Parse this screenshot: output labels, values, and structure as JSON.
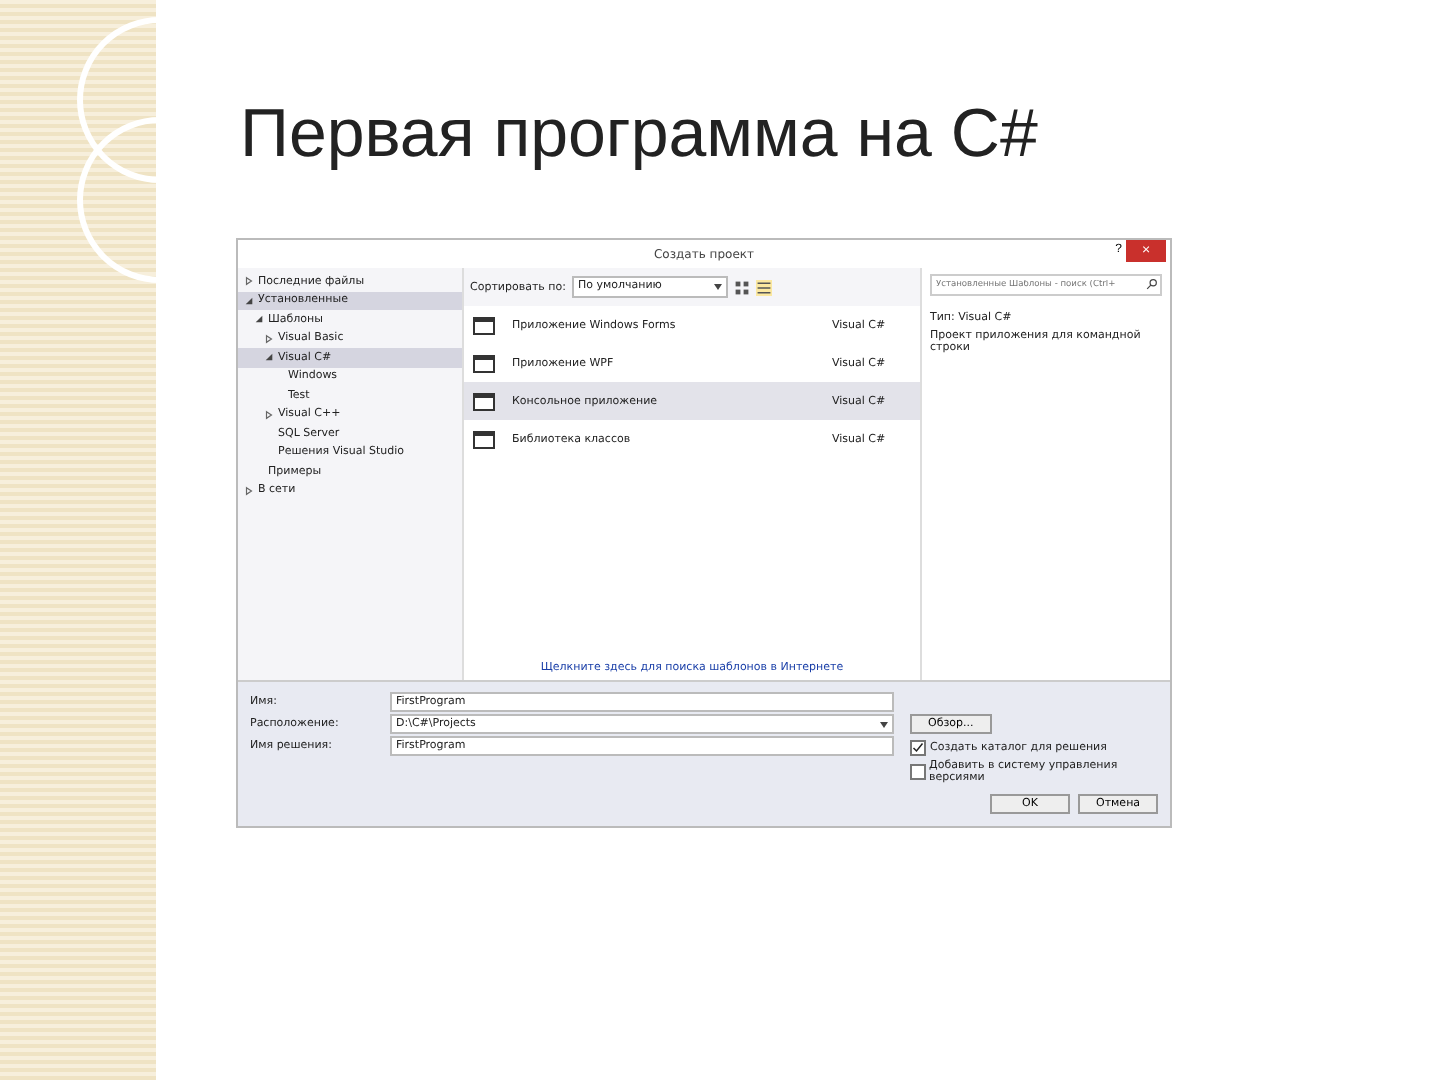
{
  "slide_title": "Первая программа на C#",
  "dialog": {
    "title": "Создать проект",
    "help": "?",
    "close": "×",
    "sidebar": {
      "sections": [
        {
          "label": "Последние файлы",
          "expanded": false,
          "selected": false
        },
        {
          "label": "Установленные",
          "expanded": true,
          "selected": true,
          "children": [
            {
              "label": "Шаблоны",
              "expanded": true,
              "selected": false,
              "children": [
                {
                  "label": "Visual Basic",
                  "expanded": false,
                  "selected": false
                },
                {
                  "label": "Visual C#",
                  "expanded": true,
                  "selected": true,
                  "children": [
                    {
                      "label": "Windows",
                      "selected": false
                    },
                    {
                      "label": "Test",
                      "selected": false
                    }
                  ]
                },
                {
                  "label": "Visual C++",
                  "expanded": false,
                  "selected": false
                },
                {
                  "label": "SQL Server",
                  "selected": false
                },
                {
                  "label": "Решения Visual Studio",
                  "selected": false
                }
              ]
            },
            {
              "label": "Примеры",
              "selected": false
            }
          ]
        },
        {
          "label": "В сети",
          "expanded": false,
          "selected": false
        }
      ]
    },
    "sort_label": "Сортировать по:",
    "sort_value": "По умолчанию",
    "templates": [
      {
        "name": "Приложение Windows Forms",
        "lang": "Visual C#",
        "selected": false
      },
      {
        "name": "Приложение WPF",
        "lang": "Visual C#",
        "selected": false
      },
      {
        "name": "Консольное приложение",
        "lang": "Visual C#",
        "selected": true
      },
      {
        "name": "Библиотека классов",
        "lang": "Visual C#",
        "selected": false
      }
    ],
    "online_link": "Щелкните здесь для поиска шаблонов в Интернете",
    "search": {
      "placeholder": "Установленные Шаблоны - поиск (Ctrl+"
    },
    "details": {
      "type": "Тип: Visual C#",
      "description": "Проект приложения для командной строки"
    },
    "fields": [
      {
        "label": "Имя:",
        "value": "FirstProgram",
        "kind": "text"
      },
      {
        "label": "Расположение:",
        "value": "D:\\C#\\Projects",
        "kind": "combo"
      },
      {
        "label": "Имя решения:",
        "value": "FirstProgram",
        "kind": "text"
      }
    ],
    "browse": "Обзор...",
    "checkboxes": [
      {
        "label": "Создать каталог для решения",
        "checked": true
      },
      {
        "label": "Добавить в систему управления версиями",
        "checked": false
      }
    ],
    "buttons": [
      "OK",
      "Отмена"
    ]
  }
}
